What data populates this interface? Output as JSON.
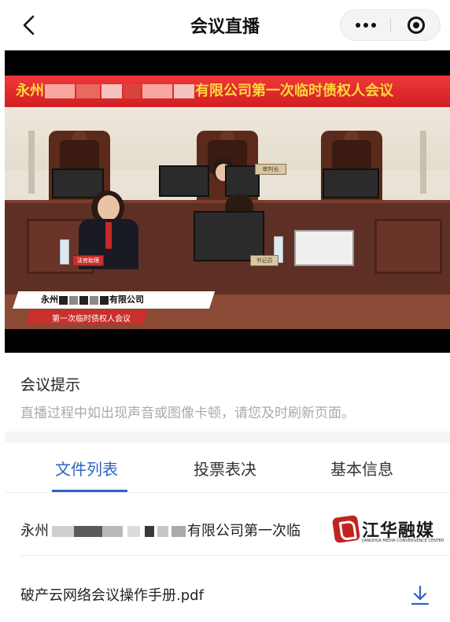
{
  "nav": {
    "title": "会议直播",
    "back_icon": "chevron-left-icon",
    "more_icon": "more-dots-icon",
    "close_icon": "target-circle-icon"
  },
  "video": {
    "banner_prefix": "永州",
    "banner_suffix": "有限公司第一次临时债权人会议",
    "caption_line1_prefix": "永州",
    "caption_line1_suffix": "有限公司",
    "caption_line2": "第一次临时债权人会议",
    "nameplate_judge": "审判长",
    "nameplate_assistant": "法官助理",
    "nameplate_clerk": "书记员",
    "banner_color": "#d01f22",
    "banner_text_color": "#ffd83d"
  },
  "notice": {
    "title": "会议提示",
    "body": "直播过程中如出现声音或图像卡顿，请您及时刷新页面。"
  },
  "tabs": [
    {
      "label": "文件列表",
      "active": true
    },
    {
      "label": "投票表决",
      "active": false
    },
    {
      "label": "基本信息",
      "active": false
    }
  ],
  "files": [
    {
      "name_prefix": "永州",
      "name_suffix": "有限公司第一次临",
      "download": false
    },
    {
      "name": "破产云网络会议操作手册.pdf",
      "download": true,
      "download_icon": "download-icon"
    }
  ],
  "watermark": {
    "text": "江华融媒",
    "sub": "JIANGHUA MEDIA CONVERGENCE CENTER"
  },
  "colors": {
    "accent": "#2f63c2",
    "muted_text": "#aaaaaa"
  }
}
